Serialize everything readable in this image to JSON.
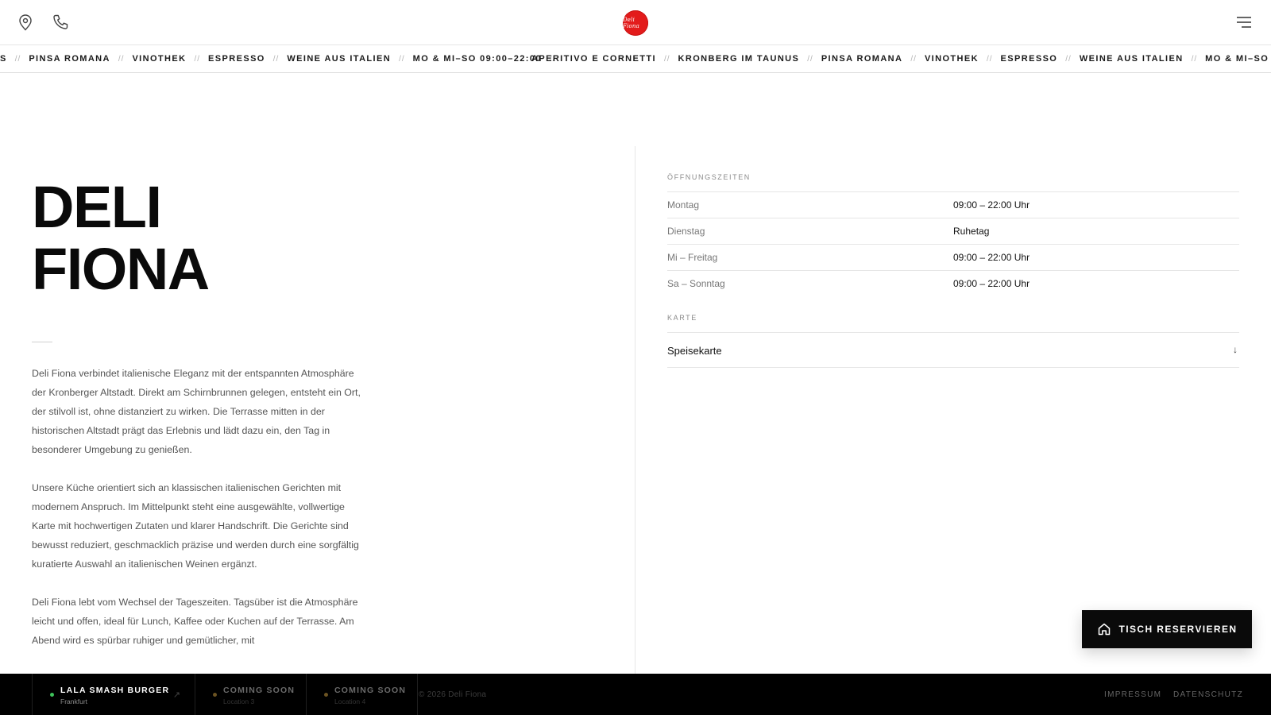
{
  "header": {
    "icons": {
      "location": "map-pin-icon",
      "phone": "phone-icon",
      "menu": "hamburger-menu-icon"
    },
    "logo_text": "Deli Fiona",
    "logo_color": "#e31b1b"
  },
  "ticker": {
    "track1": [
      "S",
      "PINSA ROMANA",
      "VINOTHEK",
      "ESPRESSO",
      "WEINE AUS ITALIEN",
      "MO & MI–SO 09:00–22:00"
    ],
    "track2": [
      "APERITIVO E CORNETTI",
      "KRONBERG IM TAUNUS",
      "PINSA ROMANA",
      "VINOTHEK",
      "ESPRESSO",
      "WEINE AUS ITALIEN",
      "MO & MI–SO 09:00–22:00"
    ],
    "separator": "//"
  },
  "main": {
    "title_line1": "DELI",
    "title_line2": "FIONA",
    "paragraphs": [
      "Deli Fiona verbindet italienische Eleganz mit der entspannten Atmosphäre der Kronberger Altstadt. Direkt am Schirnbrunnen gelegen, entsteht ein Ort, der stilvoll ist, ohne distanziert zu wirken. Die Terrasse mitten in der historischen Altstadt prägt das Erlebnis und lädt dazu ein, den Tag in besonderer Umgebung zu genießen.",
      "Unsere Küche orientiert sich an klassischen italienischen Gerichten mit modernem Anspruch. Im Mittelpunkt steht eine ausgewählte, vollwertige Karte mit hochwertigen Zutaten und klarer Handschrift. Die Gerichte sind bewusst reduziert, geschmacklich präzise und werden durch eine sorgfältig kuratierte Auswahl an italienischen Weinen ergänzt.",
      "Deli Fiona lebt vom Wechsel der Tageszeiten. Tagsüber ist die Atmosphäre leicht und offen, ideal für Lunch, Kaffee oder Kuchen auf der Terrasse. Am Abend wird es spürbar ruhiger und gemütlicher, mit"
    ]
  },
  "hours": {
    "label": "ÖFFNUNGSZEITEN",
    "rows": [
      {
        "day": "Montag",
        "time": "09:00 – 22:00 Uhr"
      },
      {
        "day": "Dienstag",
        "time": "Ruhetag"
      },
      {
        "day": "Mi – Freitag",
        "time": "09:00 – 22:00 Uhr"
      },
      {
        "day": "Sa – Sonntag",
        "time": "09:00 – 22:00 Uhr"
      }
    ]
  },
  "karte": {
    "label": "KARTE",
    "item_label": "Speisekarte",
    "item_icon": "download-arrow-icon",
    "item_arrow": "↓"
  },
  "reserve": {
    "label": "TISCH RESERVIEREN",
    "icon": "home-icon"
  },
  "footer": {
    "cards": [
      {
        "name": "LALA SMASH BURGER",
        "location": "Frankfurt",
        "dot_color": "#3ec15a",
        "name_color": "#ffffff",
        "location_color": "#8a8a8a",
        "ext": "↗"
      },
      {
        "name": "COMING SOON",
        "location": "Location 3",
        "dot_color": "#6b5322",
        "name_color": "#6a6a6a",
        "location_color": "#333333"
      },
      {
        "name": "COMING SOON",
        "location": "Location 4",
        "dot_color": "#6b5322",
        "name_color": "#6a6a6a",
        "location_color": "#333333"
      }
    ],
    "copyright": "© 2026 Deli Fiona",
    "links": [
      "IMPRESSUM",
      "DATENSCHUTZ"
    ]
  }
}
